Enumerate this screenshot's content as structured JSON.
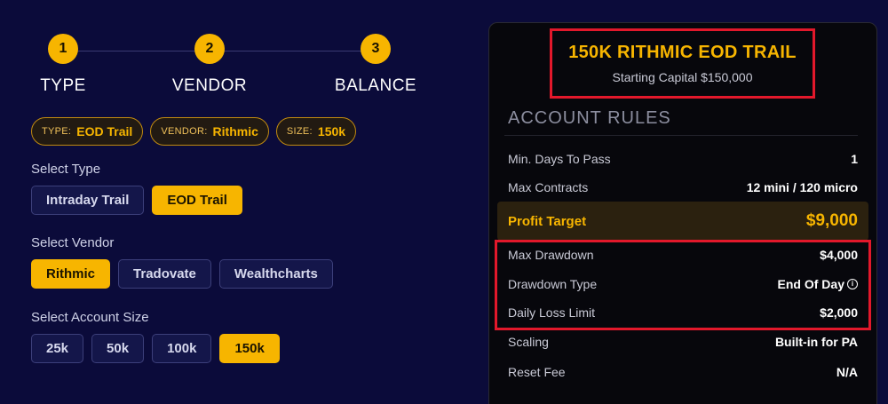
{
  "steps": [
    {
      "number": "1",
      "label": "TYPE"
    },
    {
      "number": "2",
      "label": "VENDOR"
    },
    {
      "number": "3",
      "label": "BALANCE"
    }
  ],
  "chips": [
    {
      "key": "TYPE:",
      "value": "EOD Trail"
    },
    {
      "key": "VENDOR:",
      "value": "Rithmic"
    },
    {
      "key": "SIZE:",
      "value": "150k"
    }
  ],
  "select_type": {
    "label": "Select Type",
    "options": [
      "Intraday Trail",
      "EOD Trail"
    ],
    "selected": "EOD Trail"
  },
  "select_vendor": {
    "label": "Select Vendor",
    "options": [
      "Rithmic",
      "Tradovate",
      "Wealthcharts"
    ],
    "selected": "Rithmic"
  },
  "select_size": {
    "label": "Select Account Size",
    "options": [
      "25k",
      "50k",
      "100k",
      "150k"
    ],
    "selected": "150k"
  },
  "card": {
    "title": "150K RITHMIC EOD TRAIL",
    "subtitle": "Starting Capital $150,000",
    "rules_heading": "ACCOUNT RULES",
    "rules": [
      {
        "key": "Min. Days To Pass",
        "value": "1"
      },
      {
        "key": "Max Contracts",
        "value": "12 mini / 120 micro"
      },
      {
        "key": "Profit Target",
        "value": "$9,000"
      },
      {
        "key": "Max Drawdown",
        "value": "$4,000"
      },
      {
        "key": "Drawdown Type",
        "value": "End Of Day"
      },
      {
        "key": "Daily Loss Limit",
        "value": "$2,000"
      },
      {
        "key": "Scaling",
        "value": "Built-in for PA"
      },
      {
        "key": "Reset Fee",
        "value": "N/A"
      }
    ],
    "info_icon_glyph": "i"
  },
  "colors": {
    "background": "#0b0b3a",
    "accent": "#f7b500",
    "highlight_box": "#e2182b",
    "card_bg": "#07070c"
  }
}
